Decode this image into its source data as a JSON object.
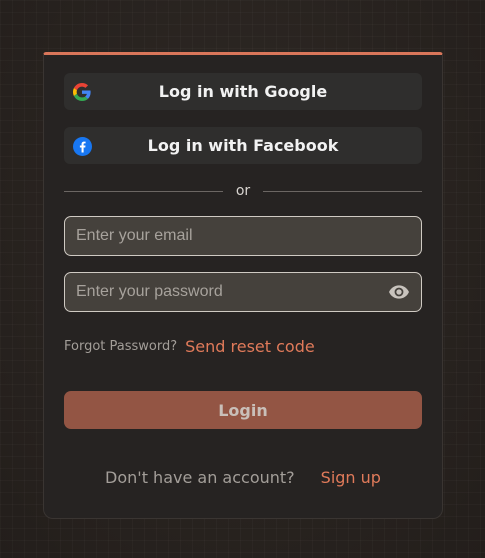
{
  "social": {
    "google_label": "Log in with Google",
    "facebook_label": "Log in with Facebook",
    "google_icon": "google-icon",
    "facebook_icon": "facebook-icon"
  },
  "divider": {
    "text": "or"
  },
  "form": {
    "email": {
      "value": "",
      "placeholder": "Enter your email"
    },
    "password": {
      "value": "",
      "placeholder": "Enter your password",
      "toggle_icon": "eye-icon"
    }
  },
  "forgot": {
    "text": "Forgot Password?",
    "link": "Send reset code"
  },
  "login": {
    "label": "Login"
  },
  "signup": {
    "text": "Don't have an account?",
    "link": "Sign up"
  },
  "colors": {
    "accent": "#d9765a",
    "link": "#e07a5a",
    "login_button": "#935544",
    "facebook_blue": "#1877f2"
  }
}
